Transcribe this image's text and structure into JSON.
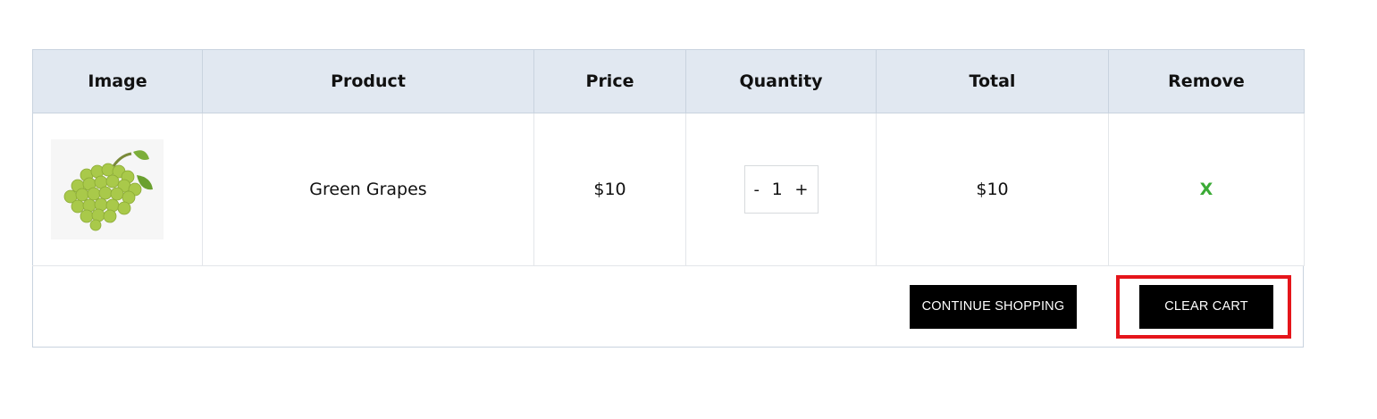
{
  "cart": {
    "headers": [
      "Image",
      "Product",
      "Price",
      "Quantity",
      "Total",
      "Remove"
    ],
    "items": [
      {
        "image_name": "green-grapes-image",
        "product": "Green Grapes",
        "price": "$10",
        "quantity": "1",
        "qty_minus": "-",
        "qty_plus": "+",
        "total": "$10",
        "remove": "X"
      }
    ]
  },
  "actions": {
    "continue_label": "CONTINUE SHOPPING",
    "clear_label": "CLEAR CART"
  },
  "colors": {
    "header_bg": "#e1e8f1",
    "remove_color": "#3aaa35",
    "button_bg": "#000000",
    "highlight": "#e5151b"
  }
}
